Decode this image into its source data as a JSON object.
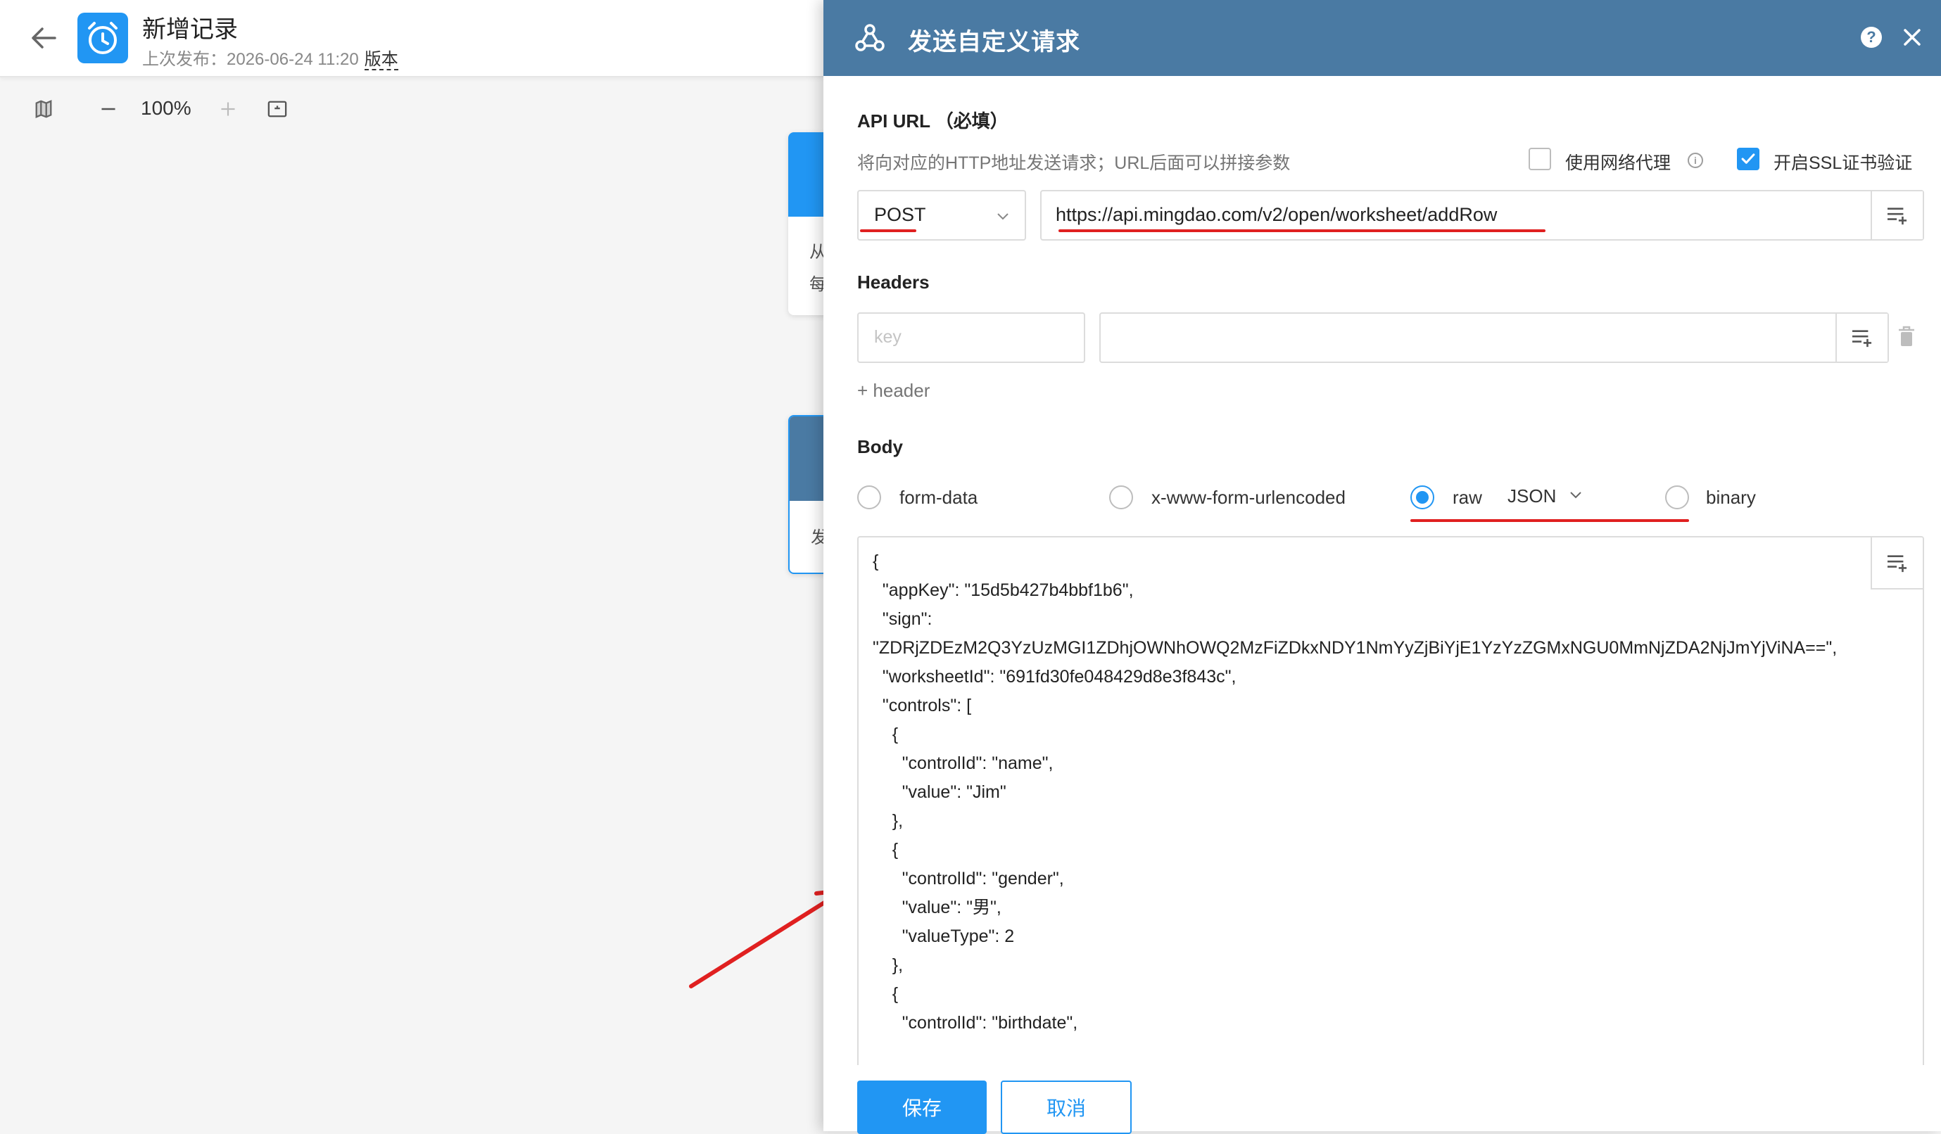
{
  "app": {
    "title": "新增记录",
    "published_label": "上次发布：2026-06-24 11:20",
    "version_link": "版本"
  },
  "toolbar": {
    "zoom": "100%"
  },
  "background_cards": {
    "card1_lines": [
      "从",
      "每"
    ],
    "card2_lines": [
      "发"
    ]
  },
  "drawer": {
    "title": "发送自定义请求",
    "help": "?",
    "api_url_label": "API URL （必填）",
    "api_url_hint": "将向对应的HTTP地址发送请求；URL后面可以拼接参数",
    "proxy_label": "使用网络代理",
    "proxy_checked": false,
    "ssl_label": "开启SSL证书验证",
    "ssl_checked": true,
    "method": "POST",
    "url": "https://api.mingdao.com/v2/open/worksheet/addRow",
    "headers_label": "Headers",
    "header_key_placeholder": "key",
    "header_value": "",
    "add_header": "+ header",
    "body_label": "Body",
    "body_types": [
      "form-data",
      "x-www-form-urlencoded",
      "raw",
      "binary"
    ],
    "selected_body_type": "raw",
    "raw_format": "JSON",
    "body_content": "{\n  \"appKey\": \"15d5b427b4bbf1b6\",\n  \"sign\":\n\"ZDRjZDEzM2Q3YzUzMGI1ZDhjOWNhOWQ2MzFiZDkxNDY1NmYyZjBiYjE1YzYzZGMxNGU0MmNjZDA2NjJmYjViNA==\",\n  \"worksheetId\": \"691fd30fe048429d8e3f843c\",\n  \"controls\": [\n    {\n      \"controlId\": \"name\",\n      \"value\": \"Jim\"\n    },\n    {\n      \"controlId\": \"gender\",\n      \"value\": \"男\",\n      \"valueType\": 2\n    },\n    {\n      \"controlId\": \"birthdate\","
  },
  "footer": {
    "save": "保存",
    "cancel": "取消"
  },
  "colors": {
    "header_bg": "#4a7aa3",
    "primary": "#2196f3",
    "annotation_red": "#e02020"
  }
}
